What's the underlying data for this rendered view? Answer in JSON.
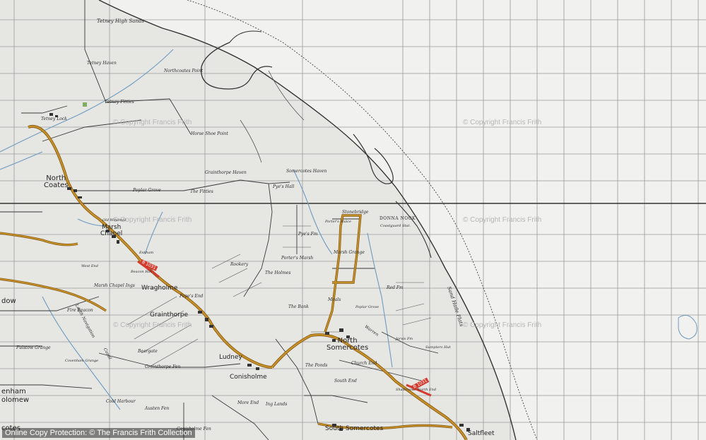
{
  "map": {
    "colors": {
      "paper": "#efefec",
      "grid": "#9a9a9a",
      "line": "#3a3a3a",
      "road_main": "#c8922a",
      "road_main_edge": "#8a5d14",
      "water": "#6f9bc0",
      "tone": "#d8d8d6",
      "red_road": "#d23b2e"
    }
  },
  "labels": {
    "tetney_high_sands": "Tetney High Sands",
    "tetney_haven": "Tetney Haven",
    "northcoates_point": "Northcoates Point",
    "tetney_fitties": "Tetney Fitties",
    "tetney_lock": "Tetney Lock",
    "horse_shoe_point": "Horse Shoe Point",
    "grainthorpe_haven": "Grainthorpe Haven",
    "somercotes_haven": "Somercotes Haven",
    "pyes_hall": "Pye's Hall",
    "the_fitties": "The Fitties",
    "poplar_grove": "Poplar Grove",
    "stonebridge": "Stonebridge",
    "donna_nook": "DONNA NOOK",
    "coastguard_stat": "Coastguard Stat.",
    "porters_sluice": "Porter's Sluice",
    "pyes_farm": "Pye's Fm",
    "porters_marsh": "Porter's Marsh",
    "marsh_grange": "Marsh Grange",
    "the_holmes": "The Holmes",
    "rookery": "Rookery",
    "old_windmill": "Old Windmill",
    "eskham": "Eskham",
    "west_end": "West End",
    "beacon_hill": "Beacon Hill",
    "marsh_chapel_ings": "Marsh Chapel Ings",
    "fire_beacon": "Fire Beacon",
    "popes_end": "Pope's End",
    "the_bank": "The Bank",
    "poplar_grove_2": "Poplar Grove",
    "red_farm": "Red Fm",
    "sand_haile_flats": "Sand Haile Flats",
    "warren": "Warren",
    "jarvis_farm": "Jarvis Fm",
    "sumpters_hut": "Sumpters Hut",
    "fulstow_grange": "Fulstow Grange",
    "covenham_grange": "Covenham Grange",
    "beargate": "Beargate",
    "grainthorpe_fen": "Grainthorpe Fen",
    "church_end": "Church End",
    "south_end": "South End",
    "cold_harbour": "Cold Harbour",
    "austen_fen": "Austen Fen",
    "more_end": "More End",
    "ing_lands": "Ing Lands",
    "shalbrooke_north_end": "Shalbrooke North End",
    "conisholme_fen": "Conisholme Fen",
    "louth_navigation": "Louth Navigation",
    "canal": "Canal",
    "meals": "Meals",
    "the_ponds": "The Ponds"
  },
  "towns": {
    "north_coates": "North\nCoates",
    "marsh_chapel": "Marsh\nChapel",
    "wragholme": "Wragholme",
    "grainthorpe": "Grainthorpe",
    "ludney": "Ludney",
    "conisholme": "Conisholme",
    "north_somercotes": "North\nSomercotes",
    "south_somercotes": "South Somercotes",
    "saltfleet": "Saltfleet",
    "covenham": "enham",
    "holomew": "olomew",
    "cotes": "cotes",
    "dow": "dow"
  },
  "road_numbers": {
    "b1031": "B 1031",
    "b1031_b": "B 1031"
  },
  "watermarks": [
    "© Copyright Francis Frith",
    "© Copyright Francis Frith",
    "© Copyright Francis Frith",
    "© Copyright Francis Frith",
    "© Copyright Francis Frith",
    "© Copyright Francis Frith"
  ],
  "footer": "Online Copy Protection: © The Francis Frith Collection"
}
